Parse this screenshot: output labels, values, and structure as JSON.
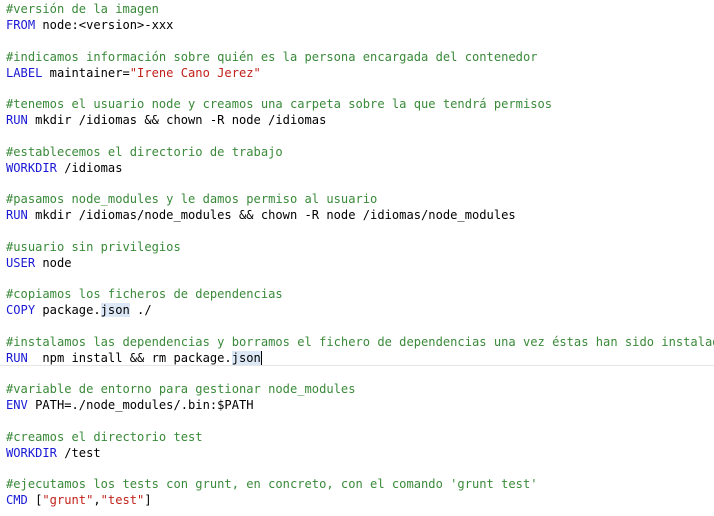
{
  "colors": {
    "comment": "#3a8a3a",
    "keyword": "#1a1ad6",
    "string": "#c2201a",
    "highlight": "#dce8f6"
  },
  "lines": [
    {
      "comment": "#versión de la imagen"
    },
    {
      "keyword": "FROM",
      "text": " node:<version>-xxx"
    },
    {
      "comment": "#indicamos información sobre quién es la persona encargada del contenedor"
    },
    {
      "keyword": "LABEL",
      "text": " maintainer=",
      "string": "\"Irene Cano Jerez\""
    },
    {
      "comment": "#tenemos el usuario node y creamos una carpeta sobre la que tendrá permisos"
    },
    {
      "keyword": "RUN",
      "text": " mkdir /idiomas && chown -R node /idiomas"
    },
    {
      "comment": "#establecemos el directorio de trabajo"
    },
    {
      "keyword": "WORKDIR",
      "text": " /idiomas"
    },
    {
      "comment": "#pasamos node_modules y le damos permiso al usuario"
    },
    {
      "keyword": "RUN",
      "text": " mkdir /idiomas/node_modules && chown -R node /idiomas/node_modules"
    },
    {
      "comment": "#usuario sin privilegios"
    },
    {
      "keyword": "USER",
      "text": " node"
    },
    {
      "comment": "#copiamos los ficheros de dependencias"
    },
    {
      "keyword": "COPY",
      "text_a": " package.",
      "hl": "json",
      "text_b": " ./"
    },
    {
      "comment": "#instalamos las dependencias y borramos el fichero de dependencias una vez éstas han sido instaladas"
    },
    {
      "keyword": "RUN",
      "text_a": "  npm install && rm package.",
      "hl": "json"
    },
    {
      "comment": "#variable de entorno para gestionar node_modules"
    },
    {
      "keyword": "ENV",
      "text": " PATH=./node_modules/.bin:$PATH"
    },
    {
      "comment": "#creamos el directorio test"
    },
    {
      "keyword": "WORKDIR",
      "text": " /test"
    },
    {
      "comment": "#ejecutamos los tests con grunt, en concreto, con el comando 'grunt test'"
    },
    {
      "keyword": "CMD",
      "text_a": " [",
      "s1": "\"grunt\"",
      "comma": ",",
      "s2": "\"test\"",
      "text_b": "]"
    }
  ]
}
